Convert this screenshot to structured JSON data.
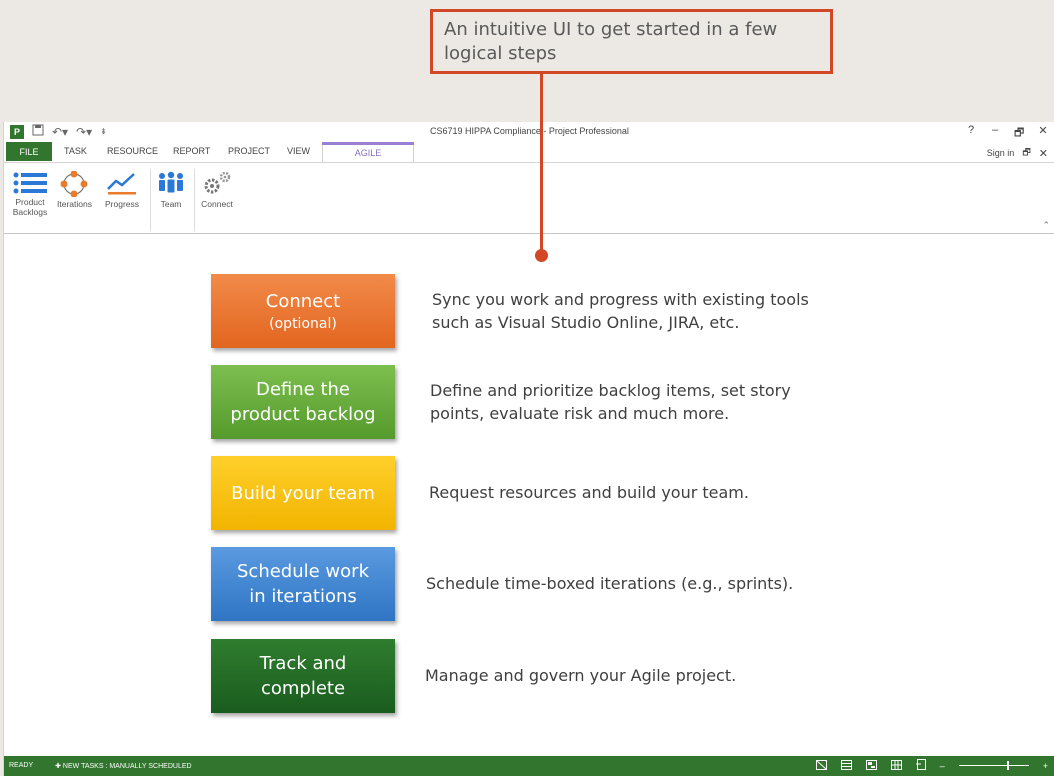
{
  "callout": {
    "text": "An intuitive UI to get started in a few logical steps"
  },
  "window": {
    "title": "CS6719 HIPPA Compliance - Project Professional",
    "controls": [
      "?",
      "–",
      "🗗",
      "✕"
    ],
    "signin": "Sign in"
  },
  "tabs": [
    "FILE",
    "TASK",
    "RESOURCE",
    "REPORT",
    "PROJECT",
    "VIEW",
    "AGILE"
  ],
  "ribbon": {
    "buttons": [
      {
        "label": "Product Backlogs",
        "icon": "list-icon"
      },
      {
        "label": "Iterations",
        "icon": "cycle-icon"
      },
      {
        "label": "Progress",
        "icon": "chart-line-icon"
      },
      {
        "label": "Team",
        "icon": "people-icon"
      },
      {
        "label": "Connect",
        "icon": "gears-icon"
      }
    ]
  },
  "steps": [
    {
      "title": "Connect",
      "subtitle": "(optional)",
      "description": [
        "Sync you work and progress with existing tools",
        "such as Visual Studio Online, JIRA, etc."
      ],
      "color": "#e8732f"
    },
    {
      "title": "Define the",
      "title2": "product backlog",
      "description": [
        "Define and prioritize backlog items, set story",
        "points, evaluate risk and much more."
      ],
      "color": "#6aaf3f"
    },
    {
      "title": "Build your team",
      "description": [
        "Request resources and build your team."
      ],
      "color": "#f9c20a"
    },
    {
      "title": "Schedule work",
      "title2": "in iterations",
      "description": [
        "Schedule time-boxed iterations (e.g., sprints)."
      ],
      "color": "#3f86d3"
    },
    {
      "title": "Track and",
      "title2": "complete",
      "description": [
        "Manage and govern your Agile project."
      ],
      "color": "#236b25"
    }
  ],
  "statusbar": {
    "ready": "READY",
    "new_tasks": "✚ NEW TASKS : MANUALLY SCHEDULED",
    "zoom_minus": "–",
    "zoom_plus": "+"
  },
  "colors": {
    "accent": "#31752f",
    "callout": "#d24726",
    "agile": "#9b7fd4"
  }
}
